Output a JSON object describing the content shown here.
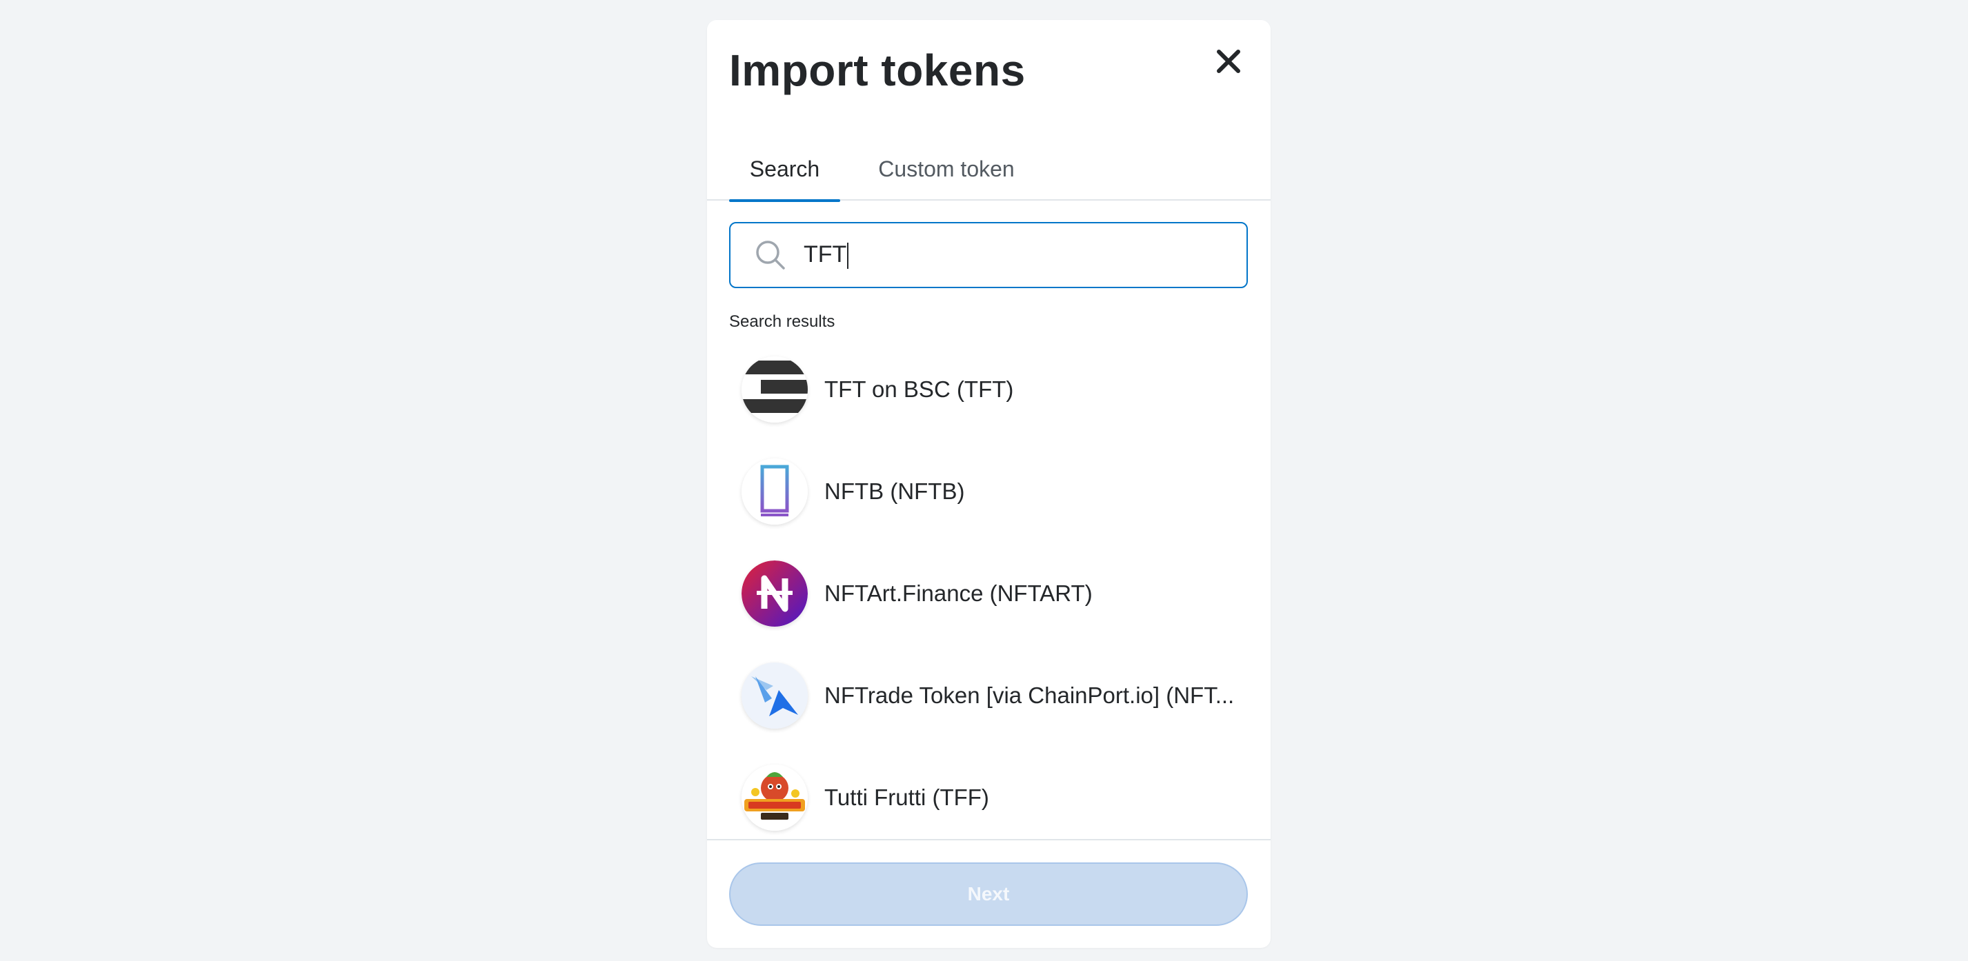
{
  "modal": {
    "title": "Import tokens",
    "close_icon": "close-icon"
  },
  "tabs": [
    {
      "label": "Search",
      "active": true
    },
    {
      "label": "Custom token",
      "active": false
    }
  ],
  "search": {
    "icon": "search-icon",
    "value": "TFT"
  },
  "results": {
    "label": "Search results",
    "items": [
      {
        "name": "TFT on BSC (TFT)",
        "logo": "tft-logo"
      },
      {
        "name": "NFTB (NFTB)",
        "logo": "nftb-logo"
      },
      {
        "name": "NFTArt.Finance (NFTART)",
        "logo": "nftart-logo"
      },
      {
        "name": "NFTrade Token [via ChainPort.io] (NFT...",
        "logo": "nftrade-logo"
      },
      {
        "name": "Tutti Frutti (TFF)",
        "logo": "tutti-frutti-logo"
      }
    ]
  },
  "footer": {
    "next_label": "Next",
    "next_enabled": false
  },
  "colors": {
    "accent": "#0376c9",
    "disabled_button": "#c8daf0",
    "background": "#f2f4f6"
  }
}
